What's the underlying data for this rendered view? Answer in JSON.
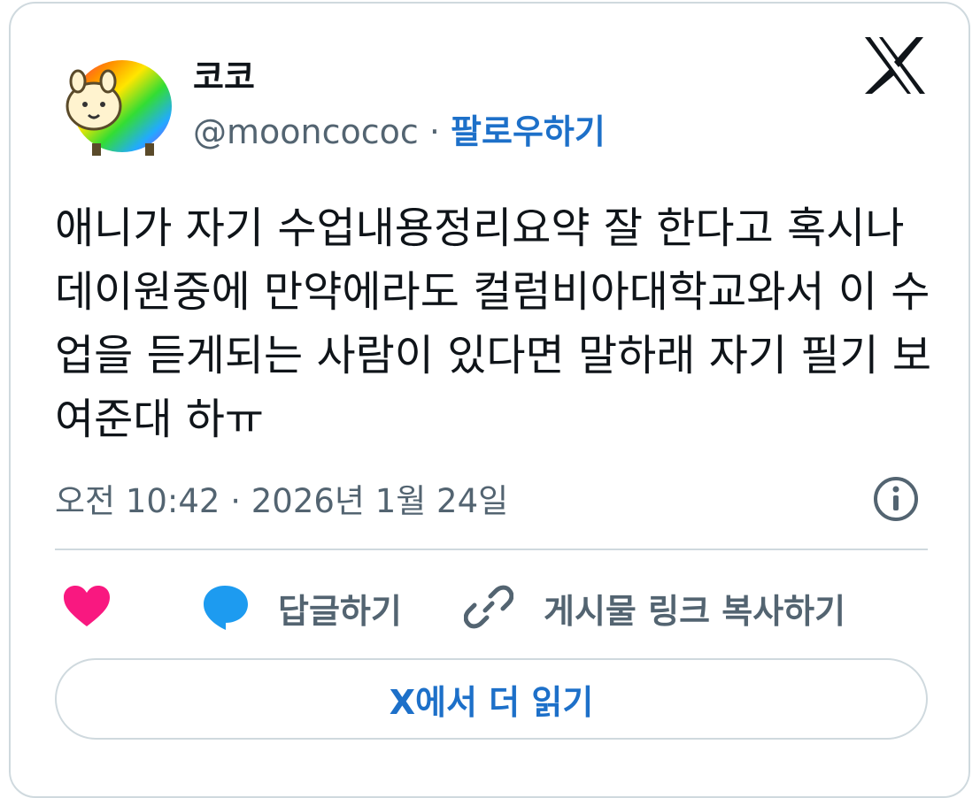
{
  "author": {
    "display_name": "코코",
    "handle": "@mooncococ",
    "separator": " · ",
    "follow_label": "팔로우하기"
  },
  "tweet": {
    "text": "애니가 자기 수업내용정리요약 잘 한다고 혹시나 데이원중에 만약에라도 컬럼비아대학교와서 이 수업을 듣게되는 사람이 있다면 말하래 자기 필기 보여준대 하ㅠ",
    "timestamp": "오전 10:42 · 2026년 1월 24일"
  },
  "actions": {
    "reply_label": "답글하기",
    "copy_link_label": "게시물 링크 복사하기"
  },
  "read_more_label": "X에서 더 읽기",
  "colors": {
    "accent": "#1d70c9",
    "heart": "#f91880",
    "reply": "#1d9bf0",
    "muted": "#536471",
    "border": "#cfd9de"
  },
  "icons": [
    "avatar",
    "x-logo-icon",
    "info-icon",
    "heart-icon",
    "reply-bubble-icon",
    "link-icon"
  ]
}
